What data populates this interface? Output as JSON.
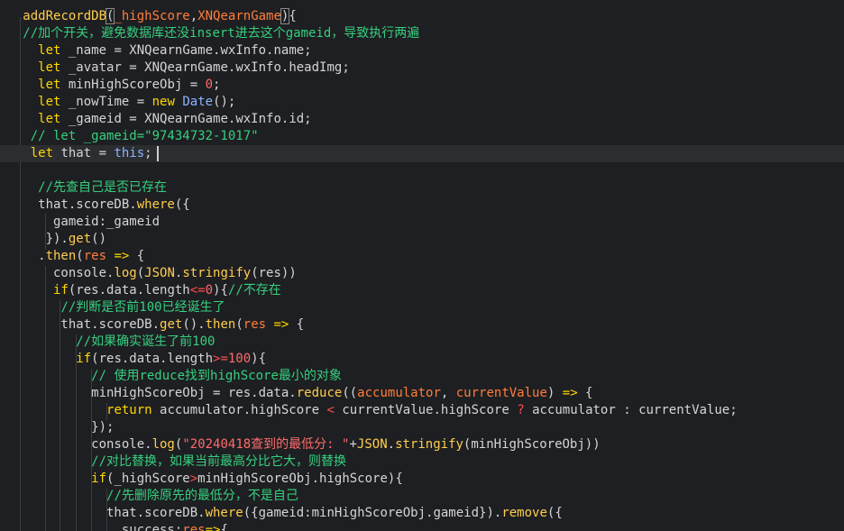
{
  "editor": {
    "lines": [
      "addRecordDB(_highScore,XNQearnGame){",
      "  //加个开关，避免数据库还没insert进去这个gameid，导致执行两遍",
      "  let _name = XNQearnGame.wxInfo.name;",
      "  let _avatar = XNQearnGame.wxInfo.headImg;",
      "  let minHighScoreObj = 0;",
      "  let _nowTime = new Date();",
      "  let _gameid = XNQearnGame.wxInfo.id;",
      "// let _gameid=\"97434732-1017\"",
      "let that = this;",
      "",
      "  //先查自己是否已存在",
      "  that.scoreDB.where({",
      "    gameid:_gameid",
      "   }).get()",
      "  .then(res => {",
      "    console.log(JSON.stringify(res))",
      "    if(res.data.length<=0){//不存在",
      "     //判断是否前100已经诞生了",
      "     that.scoreDB.get().then(res => {",
      "       //如果确实诞生了前100",
      "       if(res.data.length>=100){",
      "         // 使用reduce找到highScore最小的对象",
      "         minHighScoreObj = res.data.reduce((accumulator, currentValue) => {",
      "           return accumulator.highScore < currentValue.highScore ? accumulator : currentValue;",
      "         });",
      "         console.log(\"20240418查到的最低分: \"+JSON.stringify(minHighScoreObj))",
      "         //对比替换，如果当前最高分比它大，则替换",
      "         if(_highScore>minHighScoreObj.highScore){",
      "           //先删除原先的最低分，不是自己",
      "           that.scoreDB.where({gameid:minHighScoreObj.gameid}).remove({",
      "             success:res=>{"
    ],
    "colors": {
      "background": "#1e1f22",
      "current_line": "#2b2d30",
      "keyword": "#ffd700",
      "comment": "#35d07f",
      "function": "#ffce4d",
      "parameter": "#ff7e3b",
      "string": "#ff6b6b"
    },
    "icons": {
      "intention": "lightbulb-icon"
    }
  }
}
